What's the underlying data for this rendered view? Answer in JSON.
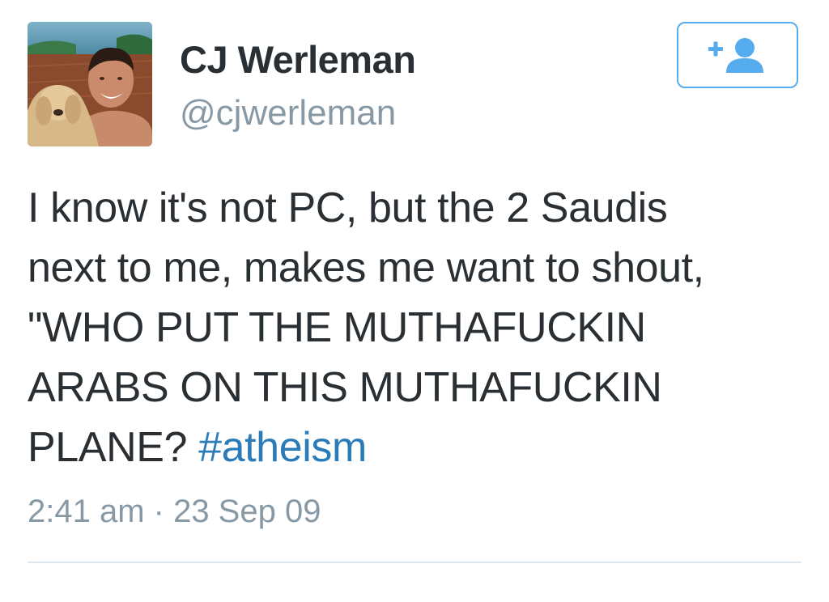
{
  "author": {
    "display_name": "CJ Werleman",
    "handle": "@cjwerleman",
    "avatar_icon": "profile-photo"
  },
  "follow_button": {
    "icon": "add-user-icon",
    "plus": "+",
    "accent_color": "#55acee"
  },
  "tweet": {
    "lines": [
      "I know it's not PC, but the 2 Saudis",
      "next to me, makes me want to shout,",
      "\"WHO PUT THE MUTHAFUCKIN",
      "ARABS ON THIS MUTHAFUCKIN",
      "PLANE? "
    ],
    "hashtag": "#atheism",
    "hashtag_color": "#2b7bb9",
    "timestamp": "2:41 am · 23 Sep 09"
  }
}
